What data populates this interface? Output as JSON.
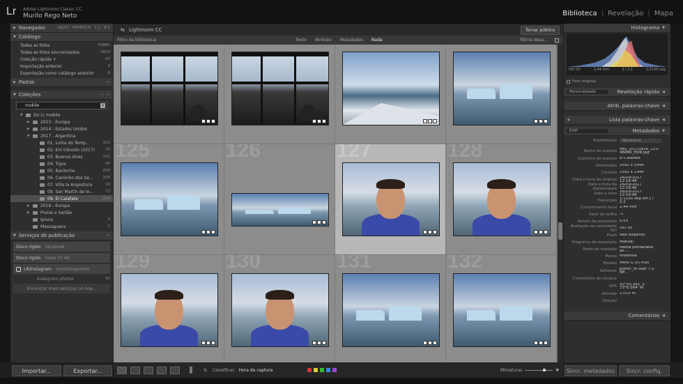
{
  "app": {
    "product": "Adobe Lightroom Classic CC",
    "user": "Murilo Rego Neto",
    "logo": "Lr"
  },
  "modules": [
    {
      "label": "Biblioteca",
      "active": true
    },
    {
      "label": "Revelação",
      "active": false
    },
    {
      "label": "Mapa",
      "active": false
    }
  ],
  "navigator": {
    "title": "Navegador",
    "options": [
      "AJUST",
      "PREENCH",
      "1:1",
      "8:1"
    ]
  },
  "catalog": {
    "title": "Catálogo",
    "items": [
      {
        "label": "Todas as fotos",
        "count": "50882"
      },
      {
        "label": "Todas as fotos sincronizadas",
        "count": "1819"
      },
      {
        "label": "Coleção rápida +",
        "count": "47"
      },
      {
        "label": "Importação anterior",
        "count": "3"
      },
      {
        "label": "Exportação como catálogo anterior",
        "count": "8"
      }
    ]
  },
  "folders": {
    "title": "Pastas"
  },
  "collections": {
    "title": "Coleções",
    "filter": "mobile",
    "tree": [
      {
        "label": "Do Lr mobile",
        "count": "",
        "level": 1
      },
      {
        "label": "2013 - Europa",
        "count": "",
        "level": 2
      },
      {
        "label": "2014 - Estados Unidos",
        "count": "",
        "level": 2
      },
      {
        "label": "2017 - Argentina",
        "count": "",
        "level": 2
      },
      {
        "label": "01. Linha do Temp...",
        "count": "912",
        "level": 3
      },
      {
        "label": "02. Em trânsito (2017)",
        "count": "76",
        "level": 3
      },
      {
        "label": "03. Buenos Aires",
        "count": "191",
        "level": 3
      },
      {
        "label": "04. Tigre",
        "count": "45",
        "level": 3
      },
      {
        "label": "05. Bariloche",
        "count": "204",
        "level": 3
      },
      {
        "label": "06. Caminho dos Se...",
        "count": "158",
        "level": 3
      },
      {
        "label": "07. Villa la Angostura",
        "count": "16",
        "level": 3
      },
      {
        "label": "08. San Martín de lo...",
        "count": "72",
        "level": 3
      },
      {
        "label": "09. El Calafate",
        "count": "214",
        "level": 3,
        "selected": true
      },
      {
        "label": "2018 - Europa",
        "count": "",
        "level": 2
      },
      {
        "label": "Praias e Sertão",
        "count": "",
        "level": 2
      },
      {
        "label": "Ipioca",
        "count": "0",
        "level": 2
      },
      {
        "label": "Massaguera",
        "count": "0",
        "level": 2
      }
    ]
  },
  "publish": {
    "title": "Serviços de publicação",
    "services": [
      {
        "label": "Disco rígido",
        "sub": "Facebook"
      },
      {
        "label": "Disco rígido",
        "sub": "Fotos TV 4K"
      },
      {
        "label": "LR/Instagram",
        "sub": "murilorregoneto"
      }
    ],
    "instagram_item": "Instagram photos",
    "instagram_count": "90",
    "find_more": "Encontrar mais serviços on-line..."
  },
  "left_buttons": {
    "import": "Importar...",
    "export": "Exportar..."
  },
  "source": {
    "title": "Lightroom CC",
    "publish": "Tornar público"
  },
  "filterbar": {
    "label": "Filtro da biblioteca:",
    "tabs": [
      "Texto",
      "Atributo",
      "Metadados",
      "Nada"
    ],
    "active": "Nada",
    "right": "Filtros desa..."
  },
  "grid": {
    "cells": [
      {
        "num": "",
        "type": "boat"
      },
      {
        "num": "",
        "type": "boat"
      },
      {
        "num": "",
        "type": "deck"
      },
      {
        "num": "",
        "type": "ice"
      },
      {
        "num": "125",
        "type": "ice"
      },
      {
        "num": "126",
        "type": "ice-wide"
      },
      {
        "num": "127",
        "type": "selfie",
        "selected": true
      },
      {
        "num": "128",
        "type": "selfie"
      },
      {
        "num": "129",
        "type": "selfie"
      },
      {
        "num": "130",
        "type": "selfie"
      },
      {
        "num": "131",
        "type": "ice"
      },
      {
        "num": "132",
        "type": "ice"
      }
    ]
  },
  "toolbar": {
    "sort_label": "Classificar:",
    "sort_value": "Hora da captura",
    "thumbs": "Miniaturas"
  },
  "label_colors": [
    "#d33",
    "#dc3",
    "#3b3",
    "#38d",
    "#94d"
  ],
  "histogram": {
    "title": "Histograma",
    "iso": "ISO 50",
    "focal": "2,44 mm",
    "aperture": "ƒ / 2.2",
    "shutter": "1/1100 seg",
    "original": "Foto original"
  },
  "quick_develop": {
    "title": "Revelação rápida",
    "preset": "Personalizado"
  },
  "keywording": {
    "title": "Atrib. palavras-chave"
  },
  "keyword_list": {
    "title": "Lista palavras-chave"
  },
  "metadata": {
    "title": "Metadados",
    "mode": "EXIF",
    "preset_label": "Predefinição",
    "preset_value": "Nenhuma",
    "fields": [
      {
        "k": "Nome do arquivo",
        "v": "IMG_20170926_1219 46066_HDR.jpg"
      },
      {
        "k": "Caminho do arquivo",
        "v": "El Calafate"
      },
      {
        "k": "Dimensões",
        "v": "2592 x 1944"
      },
      {
        "k": "Cortado",
        "v": "2592 x 1944"
      },
      {
        "k": "Data e hora do original",
        "v": "26/09/2017 12:19:46"
      },
      {
        "k": "Data e hora da digitalização",
        "v": "26/09/2017 12:19:46"
      },
      {
        "k": "Data e hora",
        "v": "26/09/2017 12:19:46"
      },
      {
        "k": "Exposição",
        "v": "1/1100 seg em ƒ / 2.2"
      },
      {
        "k": "Comprimento focal",
        "v": "2,44 mm"
      },
      {
        "k": "Valor do brilho",
        "v": "-1"
      },
      {
        "k": "Desvio da exposição",
        "v": "0 EV"
      },
      {
        "k": "Avaliação da velocidade ISO",
        "v": "ISO 50"
      },
      {
        "k": "Flash",
        "v": "Não disparou"
      },
      {
        "k": "Programa de exposição",
        "v": "Manual"
      },
      {
        "k": "Modo de medição",
        "v": "Média ponderada ao ..."
      },
      {
        "k": "Marca",
        "v": "motorola"
      },
      {
        "k": "Modelo",
        "v": "Moto G (5) Plus"
      },
      {
        "k": "Software",
        "v": "potter_nt-user 7.0 NP..."
      },
      {
        "k": "Comentário do Usuário",
        "v": ""
      },
      {
        "k": "GPS",
        "v": "50°50.391' S 73°0.564' W"
      },
      {
        "k": "Altitude",
        "v": "170,0 m"
      },
      {
        "k": "Direção",
        "v": ""
      }
    ]
  },
  "comments": {
    "title": "Comentários"
  },
  "right_buttons": {
    "sync_meta": "Sincr. metadados",
    "sync_settings": "Sincr. config."
  }
}
